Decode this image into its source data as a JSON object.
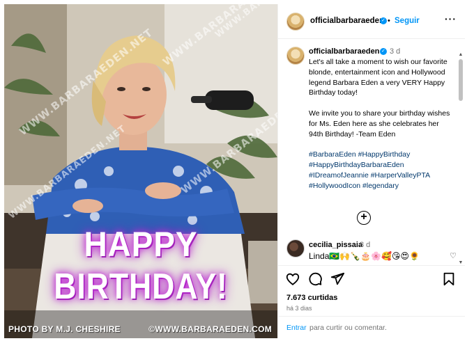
{
  "photo": {
    "watermark": "WWW.BARBARAEDEN.NET",
    "headline_line1": "HAPPY",
    "headline_line2": "BIRTHDAY!",
    "credit_left": "PHOTO BY M.J. CHESHIRE",
    "credit_right": "©WWW.BARBARAEDEN.COM"
  },
  "header": {
    "username": "officialbarbaraeden",
    "separator": "•",
    "follow_label": "Seguir",
    "more_label": "···",
    "avatar_icon": "profile-avatar"
  },
  "caption": {
    "username": "officialbarbaraeden",
    "time": "3 d",
    "paragraph1": "Let's all take a moment to wish our favorite blonde, entertainment icon and Hollywood legend Barbara Eden a very VERY Happy Birthday today!",
    "paragraph2": "We invite you to share your birthday wishes for Ms. Eden here as she celebrates her 94th Birthday! -Team Eden",
    "hashtags": [
      "#BarbaraEden #HappyBirthday",
      "#HappyBirthdayBarbaraEden",
      "#IDreamofJeannie #HarperValleyPTA",
      "#HollywoodIcon #legendary"
    ],
    "load_more_icon": "plus-circle-icon"
  },
  "comment": {
    "username": "cecilia_pissaia",
    "time": "3 d",
    "text": "Linda🇧🇷🙌🍾🎂🌸🥰😘😍🌻"
  },
  "actions": {
    "likes": "7.673 curtidas",
    "ago": "há 3 dias"
  },
  "add_comment": {
    "login_link": "Entrar",
    "login_rest": "para curtir ou comentar."
  },
  "colors": {
    "link_blue": "#0095f6",
    "hashtag_blue": "#00376b",
    "muted_gray": "#737373",
    "glow_purple": "#c62bd8"
  }
}
